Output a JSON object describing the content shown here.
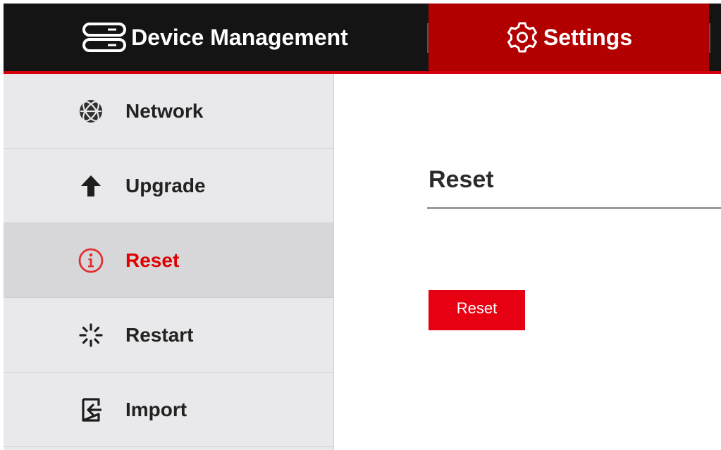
{
  "topnav": {
    "device_management_label": "Device Management",
    "device_management_icon": "server-icon",
    "settings_label": "Settings",
    "settings_icon": "gear-icon"
  },
  "sidebar": {
    "items": [
      {
        "label": "Network",
        "icon": "globe-icon",
        "active": false
      },
      {
        "label": "Upgrade",
        "icon": "arrow-up-icon",
        "active": false
      },
      {
        "label": "Reset",
        "icon": "info-circle-icon",
        "active": true
      },
      {
        "label": "Restart",
        "icon": "spinner-icon",
        "active": false
      },
      {
        "label": "Import",
        "icon": "import-icon",
        "active": false
      }
    ]
  },
  "main": {
    "title": "Reset",
    "button_label": "Reset"
  },
  "colors": {
    "topbar_bg": "#141414",
    "active_tab_bg": "#b20000",
    "accent_red": "#e60012",
    "sidebar_bg": "#e9e9ec",
    "sidebar_active_bg": "#d7d7d9"
  }
}
